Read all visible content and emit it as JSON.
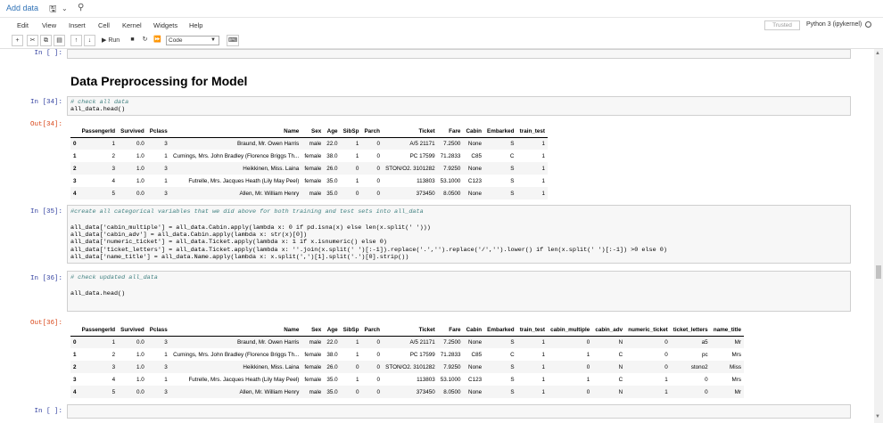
{
  "topbar": {
    "add_data": "Add data"
  },
  "menu": {
    "items": [
      "Edit",
      "View",
      "Insert",
      "Cell",
      "Kernel",
      "Widgets",
      "Help"
    ]
  },
  "status": {
    "trusted": "Trusted",
    "kernel": "Python 3 (ipykernel)"
  },
  "toolbar": {
    "run": "Run",
    "cell_type": "Code"
  },
  "cells": {
    "empty_top": {
      "prompt": "In [ ]:"
    },
    "heading": "Data Preprocessing for Model",
    "c34": {
      "prompt": "In [34]:",
      "out_prompt": "Out[34]:",
      "line1": "# check all data",
      "line2": "all_data.head()"
    },
    "c35": {
      "prompt": "In [35]:",
      "line1": "#create all categorical variables that we did above for both training and test sets into all_data",
      "line2": "all_data['cabin_multiple'] = all_data.Cabin.apply(lambda x: 0 if pd.isna(x) else len(x.split(' ')))",
      "line3": "all_data['cabin_adv'] = all_data.Cabin.apply(lambda x: str(x)[0])",
      "line4": "all_data['numeric_ticket'] = all_data.Ticket.apply(lambda x: 1 if x.isnumeric() else 0)",
      "line5": "all_data['ticket_letters'] = all_data.Ticket.apply(lambda x: ''.join(x.split(' ')[:-1]).replace('.','').replace('/','').lower() if len(x.split(' ')[:-1]) >0 else 0)",
      "line6": "all_data['name_title'] = all_data.Name.apply(lambda x: x.split(',')[1].split('.')[0].strip())"
    },
    "c36": {
      "prompt": "In [36]:",
      "out_prompt": "Out[36]:",
      "line1": "# check updated all_data",
      "line2": "all_data.head()"
    },
    "empty_bottom": {
      "prompt": "In [ ]:"
    }
  },
  "table1": {
    "columns": [
      "",
      "PassengerId",
      "Survived",
      "Pclass",
      "Name",
      "Sex",
      "Age",
      "SibSp",
      "Parch",
      "Ticket",
      "Fare",
      "Cabin",
      "Embarked",
      "train_test"
    ],
    "rows": [
      [
        "0",
        "1",
        "0.0",
        "3",
        "Braund, Mr. Owen Harris",
        "male",
        "22.0",
        "1",
        "0",
        "A/5 21171",
        "7.2500",
        "None",
        "S",
        "1"
      ],
      [
        "1",
        "2",
        "1.0",
        "1",
        "Cumings, Mrs. John Bradley (Florence Briggs Th...",
        "female",
        "38.0",
        "1",
        "0",
        "PC 17599",
        "71.2833",
        "C85",
        "C",
        "1"
      ],
      [
        "2",
        "3",
        "1.0",
        "3",
        "Heikkinen, Miss. Laina",
        "female",
        "26.0",
        "0",
        "0",
        "STON/O2. 3101282",
        "7.9250",
        "None",
        "S",
        "1"
      ],
      [
        "3",
        "4",
        "1.0",
        "1",
        "Futrelle, Mrs. Jacques Heath (Lily May Peel)",
        "female",
        "35.0",
        "1",
        "0",
        "113803",
        "53.1000",
        "C123",
        "S",
        "1"
      ],
      [
        "4",
        "5",
        "0.0",
        "3",
        "Allen, Mr. William Henry",
        "male",
        "35.0",
        "0",
        "0",
        "373450",
        "8.0500",
        "None",
        "S",
        "1"
      ]
    ]
  },
  "table2": {
    "columns": [
      "",
      "PassengerId",
      "Survived",
      "Pclass",
      "Name",
      "Sex",
      "Age",
      "SibSp",
      "Parch",
      "Ticket",
      "Fare",
      "Cabin",
      "Embarked",
      "train_test",
      "cabin_multiple",
      "cabin_adv",
      "numeric_ticket",
      "ticket_letters",
      "name_title"
    ],
    "rows": [
      [
        "0",
        "1",
        "0.0",
        "3",
        "Braund, Mr. Owen Harris",
        "male",
        "22.0",
        "1",
        "0",
        "A/5 21171",
        "7.2500",
        "None",
        "S",
        "1",
        "0",
        "N",
        "0",
        "a5",
        "Mr"
      ],
      [
        "1",
        "2",
        "1.0",
        "1",
        "Cumings, Mrs. John Bradley (Florence Briggs Th...",
        "female",
        "38.0",
        "1",
        "0",
        "PC 17599",
        "71.2833",
        "C85",
        "C",
        "1",
        "1",
        "C",
        "0",
        "pc",
        "Mrs"
      ],
      [
        "2",
        "3",
        "1.0",
        "3",
        "Heikkinen, Miss. Laina",
        "female",
        "26.0",
        "0",
        "0",
        "STON/O2. 3101282",
        "7.9250",
        "None",
        "S",
        "1",
        "0",
        "N",
        "0",
        "stono2",
        "Miss"
      ],
      [
        "3",
        "4",
        "1.0",
        "1",
        "Futrelle, Mrs. Jacques Heath (Lily May Peel)",
        "female",
        "35.0",
        "1",
        "0",
        "113803",
        "53.1000",
        "C123",
        "S",
        "1",
        "1",
        "C",
        "1",
        "0",
        "Mrs"
      ],
      [
        "4",
        "5",
        "0.0",
        "3",
        "Allen, Mr. William Henry",
        "male",
        "35.0",
        "0",
        "0",
        "373450",
        "8.0500",
        "None",
        "S",
        "1",
        "0",
        "N",
        "1",
        "0",
        "Mr"
      ]
    ]
  }
}
